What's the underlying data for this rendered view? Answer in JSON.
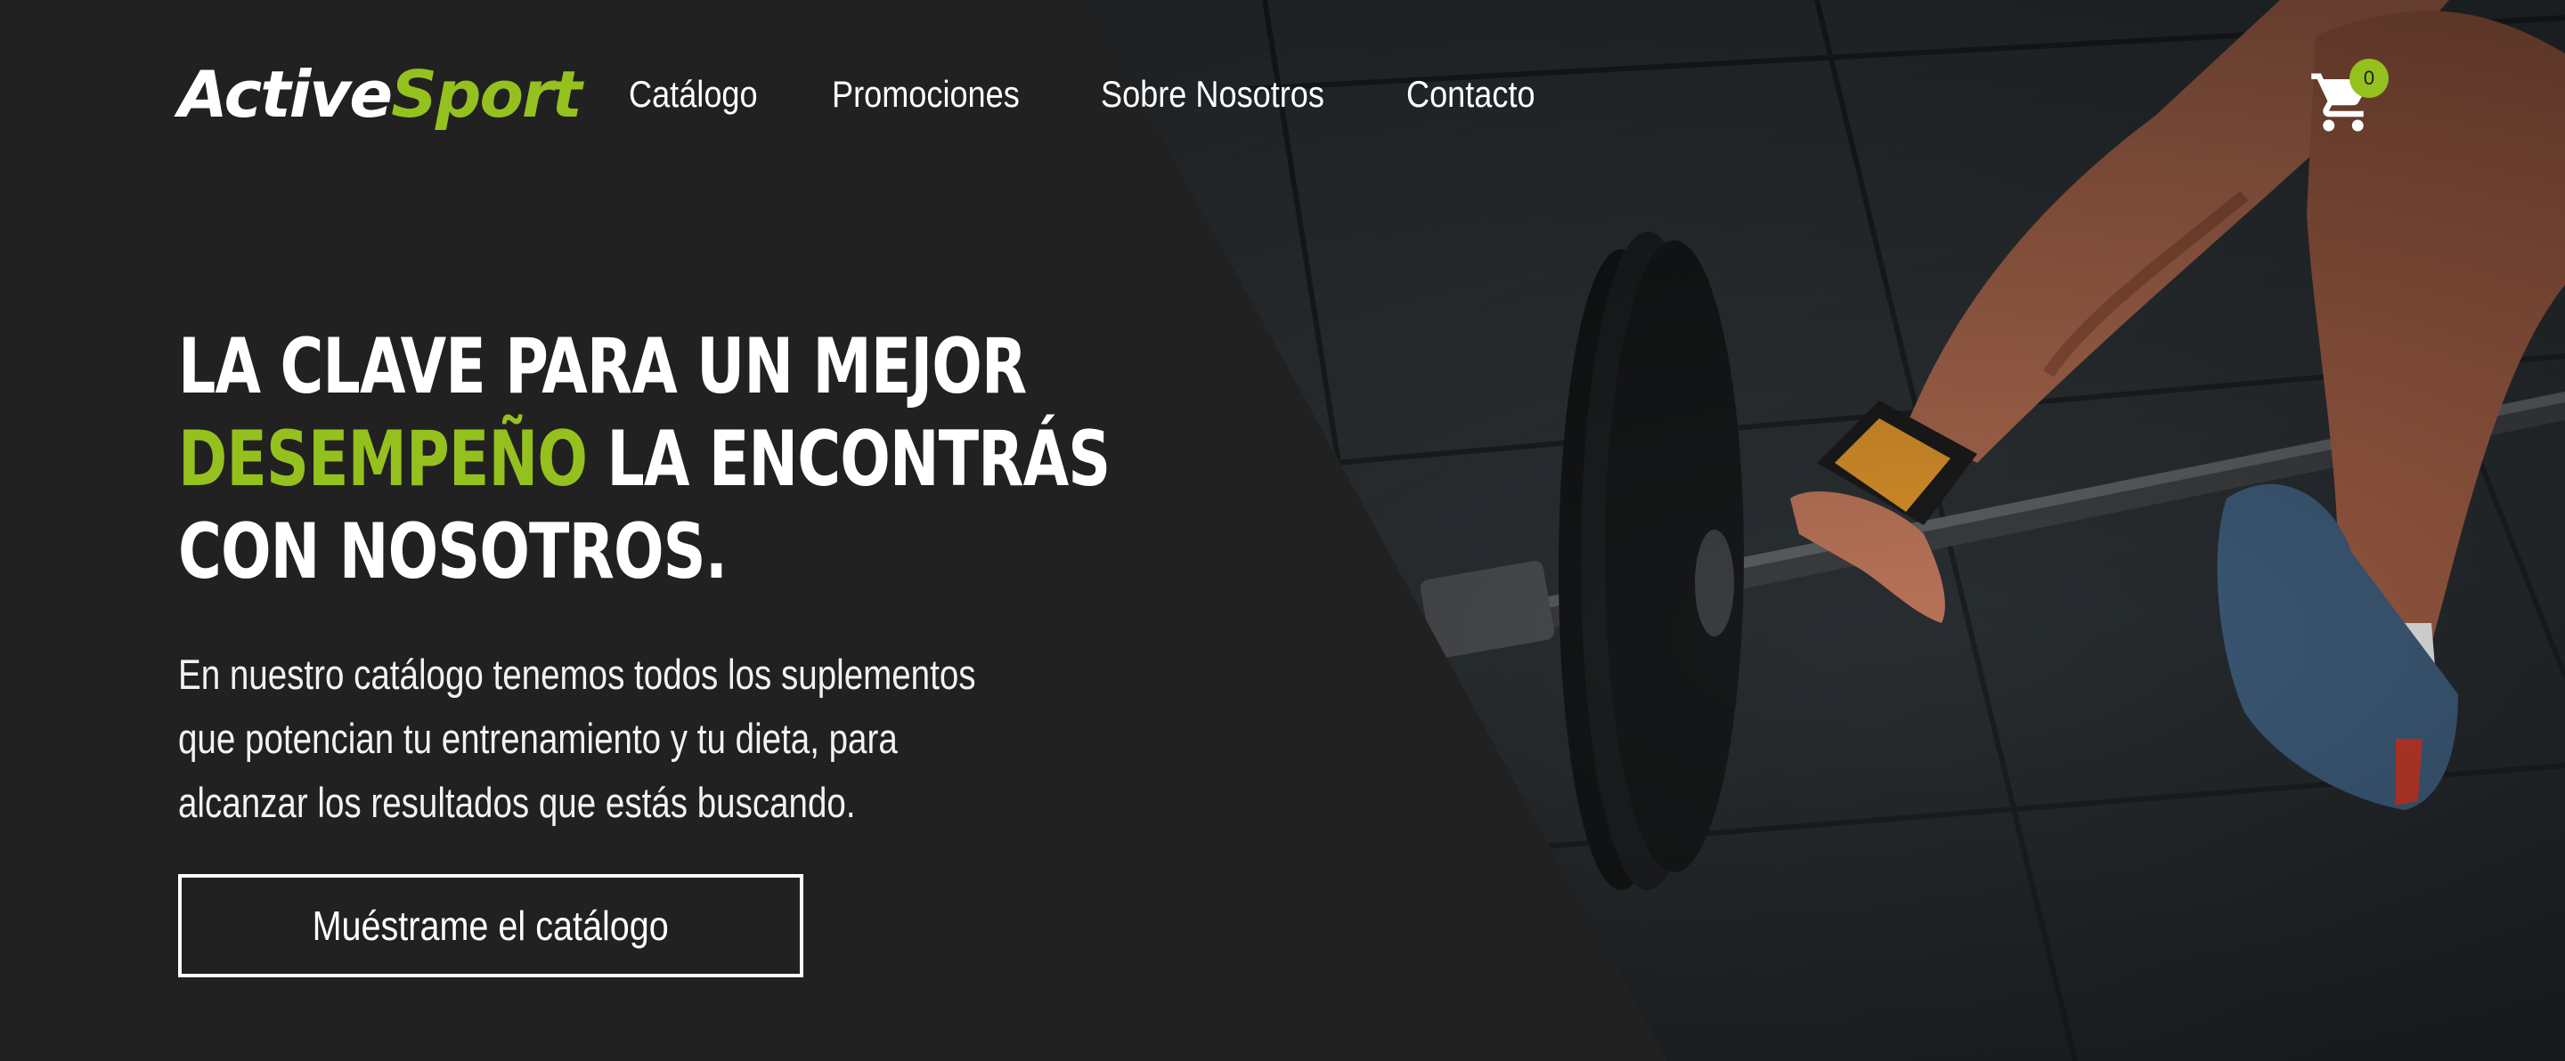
{
  "brand": {
    "part1": "Active",
    "part2": "Sport",
    "accent_color": "#95c11f"
  },
  "nav": {
    "items": [
      {
        "label": "Catálogo"
      },
      {
        "label": "Promociones"
      },
      {
        "label": "Sobre Nosotros"
      },
      {
        "label": "Contacto"
      }
    ]
  },
  "cart": {
    "count": "0",
    "icon": "shopping-cart-icon"
  },
  "hero": {
    "headline_line1": "LA CLAVE PARA UN MEJOR",
    "headline_accent": "DESEMPEÑO",
    "headline_line2_rest": " LA ENCONTRÁS",
    "headline_line3": "CON NOSOTROS.",
    "description": "En nuestro catálogo tenemos todos los suplementos que potencian tu entrenamiento y tu dieta, para alcanzar los resultados que estás buscando.",
    "cta_label": "Muéstrame el catálogo",
    "background_image": "athlete-lifting-barbell-photo"
  }
}
